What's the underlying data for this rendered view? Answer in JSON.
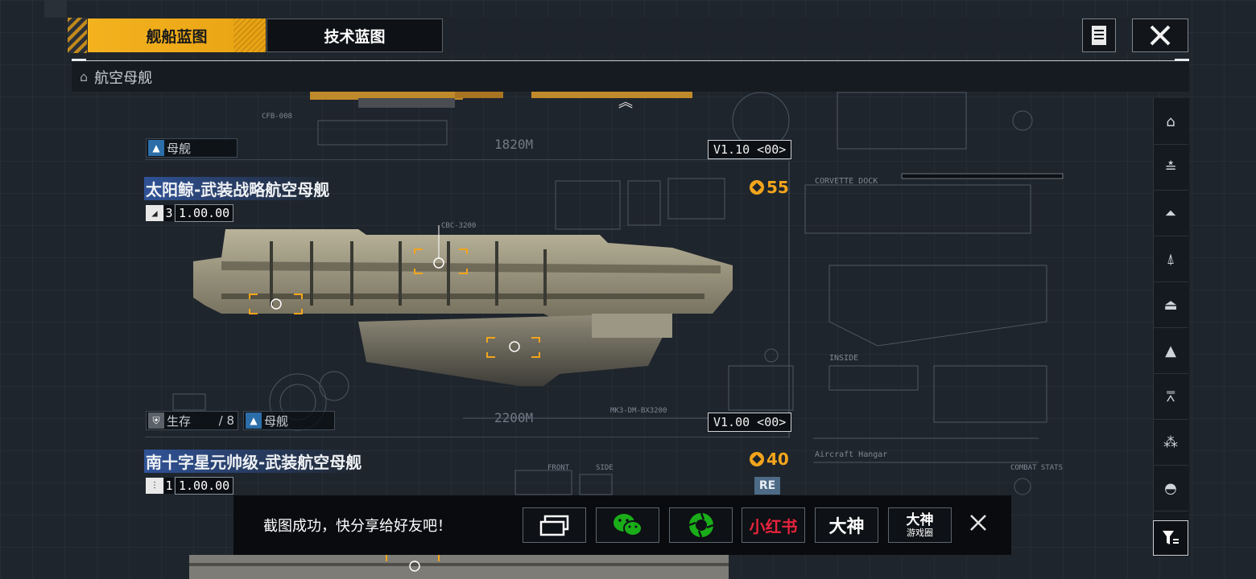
{
  "tabs": {
    "ship_blueprint": "舰船蓝图",
    "tech_blueprint": "技术蓝图"
  },
  "breadcrumb": {
    "label": "航空母舰"
  },
  "previous_entry": {
    "type_tag": "母舰",
    "dimension": "1820M",
    "version": "V1.10 <00>",
    "label_small": "CFB-008"
  },
  "ship1": {
    "name": "太阳鲸-武装战略航空母舰",
    "level_num": "3",
    "level_value": "1.00.00",
    "cost": "55",
    "dimension": "2200M",
    "version": "V1.00 <00>",
    "survival_label": "生存",
    "survival_value": "/ 8",
    "type_tag": "母舰",
    "label_top": "CBC-3200",
    "label_bottom": "MK3-DM-BX3200",
    "label_dock": "CORVETTE DOCK",
    "label_inside": "INSIDE"
  },
  "ship2": {
    "name": "南十字星元帅级-武装航空母舰",
    "level_num": "1",
    "level_value": "1.00.00",
    "cost": "40",
    "badge": "RE",
    "label_hangar": "Aircraft Hangar",
    "label_front": "FRONT",
    "label_side": "SIDE",
    "label_combat": "COMBAT STATS"
  },
  "share": {
    "message": "截图成功，快分享给好友吧！",
    "xiaohongshu": "小红书",
    "dashen": "大神",
    "dashen_circle_top": "大神",
    "dashen_circle_bottom": "游戏圈"
  },
  "colors": {
    "accent": "#f4b21f",
    "highlight_blue": "#325aaa",
    "cost_orange": "#f3a51b",
    "wechat_green": "#1aad19",
    "xhs_red": "#e8233c"
  },
  "side_nav_icons": [
    "carrier-icon",
    "cruiser-icon",
    "destroyer-icon",
    "frigate-icon",
    "corvette-icon",
    "fighter-icon",
    "support-icon",
    "squad-icon",
    "dome-icon"
  ]
}
